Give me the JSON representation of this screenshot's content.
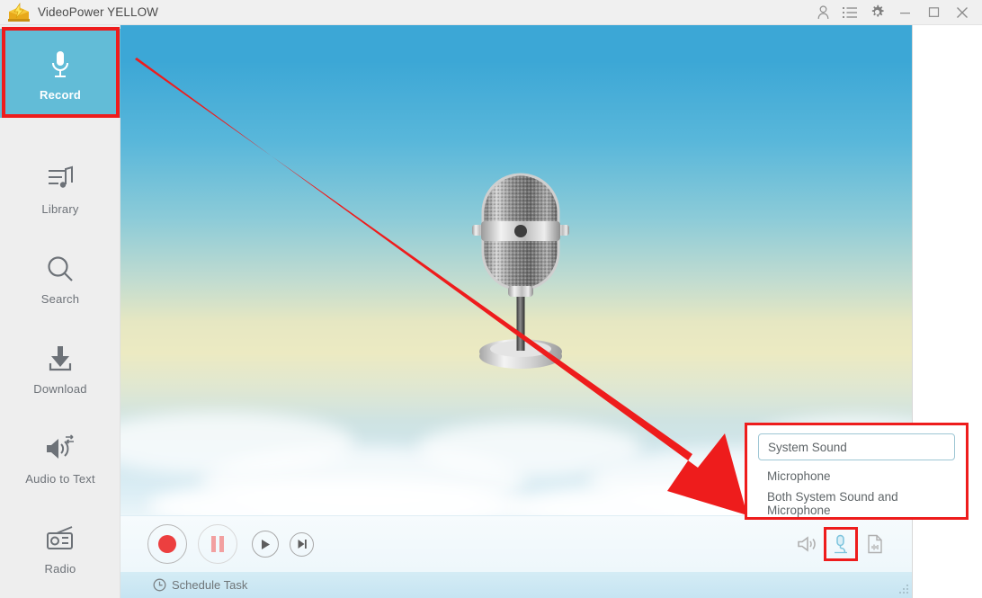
{
  "window": {
    "title": "VideoPower YELLOW",
    "logo_icon": "yellow-chest-lightning-logo",
    "titlebar_icons": [
      {
        "name": "account-icon",
        "glyph": "person"
      },
      {
        "name": "list-icon",
        "glyph": "list"
      },
      {
        "name": "gear-icon",
        "glyph": "gear"
      }
    ],
    "controls": [
      {
        "name": "minimize-button",
        "glyph": "minimize"
      },
      {
        "name": "maximize-button",
        "glyph": "maximize"
      },
      {
        "name": "close-button",
        "glyph": "close"
      }
    ]
  },
  "sidebar": {
    "items": [
      {
        "label": "Record",
        "icon": "microphone-icon",
        "active": true
      },
      {
        "label": "Library",
        "icon": "music-list-icon",
        "active": false
      },
      {
        "label": "Search",
        "icon": "magnifier-icon",
        "active": false
      },
      {
        "label": "Download",
        "icon": "download-icon",
        "active": false
      },
      {
        "label": "Audio to Text",
        "icon": "speaker-convert-icon",
        "active": false
      },
      {
        "label": "Radio",
        "icon": "radio-icon",
        "active": false
      }
    ]
  },
  "main": {
    "artwork": "vintage-microphone-on-stand",
    "controls": {
      "record_label": "Record",
      "pause_label": "Pause",
      "play_label": "Play",
      "next_label": "Next",
      "speaker_label": "System Sound Output",
      "source_label": "Recording Source",
      "export_label": "Export File"
    }
  },
  "statusbar": {
    "schedule_task_label": "Schedule Task",
    "clock_icon": "clock-icon"
  },
  "dropdown": {
    "options": [
      {
        "label": "System Sound",
        "selected": true
      },
      {
        "label": "Microphone",
        "selected": false
      },
      {
        "label": "Both System Sound and Microphone",
        "selected": false
      }
    ]
  },
  "annotations": {
    "highlight_color": "#ee1c1c",
    "record_tab_box": "red rectangle around Record sidebar tab",
    "source_button_box": "red rectangle around recording-source button",
    "dropdown_box": "red rectangle around audio source dropdown",
    "arrow": "red arrow from top-left to recording-source dropdown"
  },
  "colors": {
    "accent_teal": "#62bcd7",
    "sky_top": "#3ca7d6",
    "record_red": "#ec3f3f",
    "annotation_red": "#ee1c1c",
    "sidebar_bg": "#eeeeee",
    "titlebar_bg": "#f0f0f0"
  }
}
